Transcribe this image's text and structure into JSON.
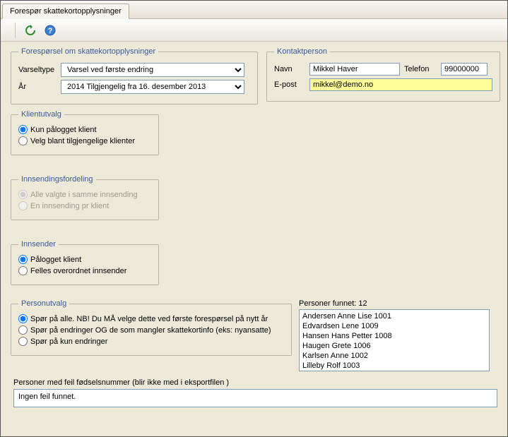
{
  "tab_title": "Forespør skattekortopplysninger",
  "request_group": {
    "legend": "Forespørsel om skattekortopplysninger",
    "varseltype_label": "Varseltype",
    "varseltype_value": "Varsel ved første endring",
    "aar_label": "År",
    "aar_value": "2014 Tilgjengelig fra 16. desember 2013"
  },
  "contact_group": {
    "legend": "Kontaktperson",
    "navn_label": "Navn",
    "navn_value": "Mikkel Haver",
    "telefon_label": "Telefon",
    "telefon_value": "99000000",
    "epost_label": "E-post",
    "epost_value": "mikkel@demo.no"
  },
  "klientutvalg": {
    "legend": "Klientutvalg",
    "opt1": "Kun pålogget klient",
    "opt2": "Velg blant tilgjengelige klienter"
  },
  "innsendingsfordeling": {
    "legend": "Innsendingsfordeling",
    "opt1": "Alle valgte i samme innsending",
    "opt2": "En innsending pr klient"
  },
  "innsender": {
    "legend": "Innsender",
    "opt1": "Pålogget klient",
    "opt2": "Felles overordnet innsender"
  },
  "personutvalg": {
    "legend": "Personutvalg",
    "opt1": "Spør på alle. NB! Du MÅ velge dette ved første forespørsel på nytt år",
    "opt2": "Spør på endringer OG de som mangler skattekortinfo (eks: nyansatte)",
    "opt3": "Spør på kun endringer"
  },
  "persons_found": {
    "label": "Personer funnet:  12",
    "items": [
      "Andersen Anne Lise 1001",
      "Edvardsen Lene 1009",
      "Hansen Hans Petter 1008",
      "Haugen Grete 1006",
      "Karlsen Anne 1002",
      "Lilleby Rolf 1003"
    ]
  },
  "errors": {
    "label": "Personer med feil fødselsnummer (blir ikke med i eksportfilen )",
    "text": "Ingen feil funnet."
  }
}
